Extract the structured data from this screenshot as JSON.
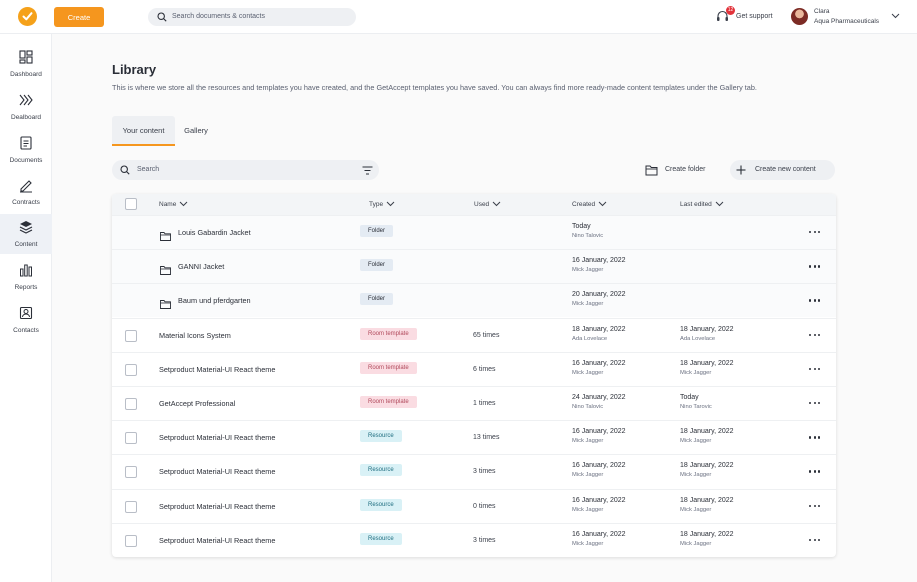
{
  "topbar": {
    "create_label": "Create",
    "search_placeholder": "Search documents & contacts",
    "support_label": "Get support",
    "support_badge": "12",
    "user_name": "Clara",
    "user_org": "Aqua Pharmaceuticals",
    "accent": "#f5961e"
  },
  "sidebar": {
    "items": [
      {
        "label": "Dashboard",
        "icon": "dashboard-icon"
      },
      {
        "label": "Dealboard",
        "icon": "dealboard-icon"
      },
      {
        "label": "Documents",
        "icon": "documents-icon"
      },
      {
        "label": "Contracts",
        "icon": "pen-icon"
      },
      {
        "label": "Content",
        "icon": "layers-icon",
        "active": true
      },
      {
        "label": "Reports",
        "icon": "bar-chart-icon"
      },
      {
        "label": "Contacts",
        "icon": "contacts-icon"
      }
    ]
  },
  "page": {
    "title": "Library",
    "description": "This is where we store all the resources and templates you have created, and the GetAccept templates you have saved. You can always find more ready-made content templates under the Gallery tab.",
    "tabs": [
      "Your content",
      "Gallery"
    ],
    "search_placeholder": "Search",
    "create_folder_label": "Create folder",
    "create_content_label": "Create new content"
  },
  "table": {
    "columns": [
      "Name",
      "Type",
      "Used",
      "Created",
      "Last edited"
    ],
    "rows": [
      {
        "name": "Louis Gabardin Jacket",
        "type": "Folder",
        "used": "",
        "created": "Today",
        "created_by": "Nino Talovic",
        "edited": "",
        "edited_by": "",
        "is_folder": true
      },
      {
        "name": "GANNI Jacket",
        "type": "Folder",
        "used": "",
        "created": "16 January, 2022",
        "created_by": "Mick Jagger",
        "edited": "",
        "edited_by": "",
        "is_folder": true
      },
      {
        "name": "Baum und pferdgarten",
        "type": "Folder",
        "used": "",
        "created": "20 January, 2022",
        "created_by": "Mick Jagger",
        "edited": "",
        "edited_by": "",
        "is_folder": true
      },
      {
        "name": "Material Icons System",
        "type": "Room template",
        "used": "65 times",
        "created": "18 January, 2022",
        "created_by": "Ada Lovelace",
        "edited": "18 January, 2022",
        "edited_by": "Ada Lovelace",
        "is_folder": false
      },
      {
        "name": "Setproduct Material-UI React theme",
        "type": "Room template",
        "used": "6 times",
        "created": "16 January, 2022",
        "created_by": "Mick Jagger",
        "edited": "18 January, 2022",
        "edited_by": "Mick Jagger",
        "is_folder": false
      },
      {
        "name": "GetAccept Professional",
        "type": "Room template",
        "used": "1 times",
        "created": "24 January, 2022",
        "created_by": "Nino Talovic",
        "edited": "Today",
        "edited_by": "Nino Tarovic",
        "is_folder": false
      },
      {
        "name": "Setproduct Material-UI React theme",
        "type": "Resource",
        "used": "13 times",
        "created": "16 January, 2022",
        "created_by": "Mick Jagger",
        "edited": "18 January, 2022",
        "edited_by": "Mick Jagger",
        "is_folder": false
      },
      {
        "name": "Setproduct Material-UI React theme",
        "type": "Resource",
        "used": "3 times",
        "created": "16 January, 2022",
        "created_by": "Mick Jagger",
        "edited": "18 January, 2022",
        "edited_by": "Mick Jagger",
        "is_folder": false
      },
      {
        "name": "Setproduct Material-UI React theme",
        "type": "Resource",
        "used": "0 times",
        "created": "16 January, 2022",
        "created_by": "Mick Jagger",
        "edited": "18 January, 2022",
        "edited_by": "Mick Jagger",
        "is_folder": false
      },
      {
        "name": "Setproduct Material-UI React theme",
        "type": "Resource",
        "used": "3 times",
        "created": "16 January, 2022",
        "created_by": "Mick Jagger",
        "edited": "18 January, 2022",
        "edited_by": "Mick Jagger",
        "is_folder": false
      }
    ]
  }
}
